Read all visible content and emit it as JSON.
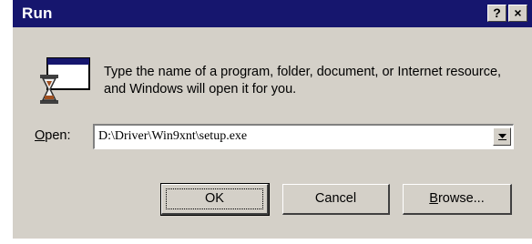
{
  "window": {
    "title": "Run",
    "help_label": "?",
    "close_label": "×"
  },
  "message": "Type the name of a program, folder, document, or Internet resource, and Windows will open it for you.",
  "open": {
    "label_first": "O",
    "label_rest": "pen:",
    "value": "D:\\Driver\\Win9xnt\\setup.exe"
  },
  "buttons": {
    "ok": "OK",
    "cancel": "Cancel",
    "browse_first": "B",
    "browse_rest": "rowse..."
  },
  "colors": {
    "titlebar": "#16166e",
    "face": "#d4d0c8"
  },
  "icons": [
    "run-icon",
    "chevron-down-icon"
  ]
}
